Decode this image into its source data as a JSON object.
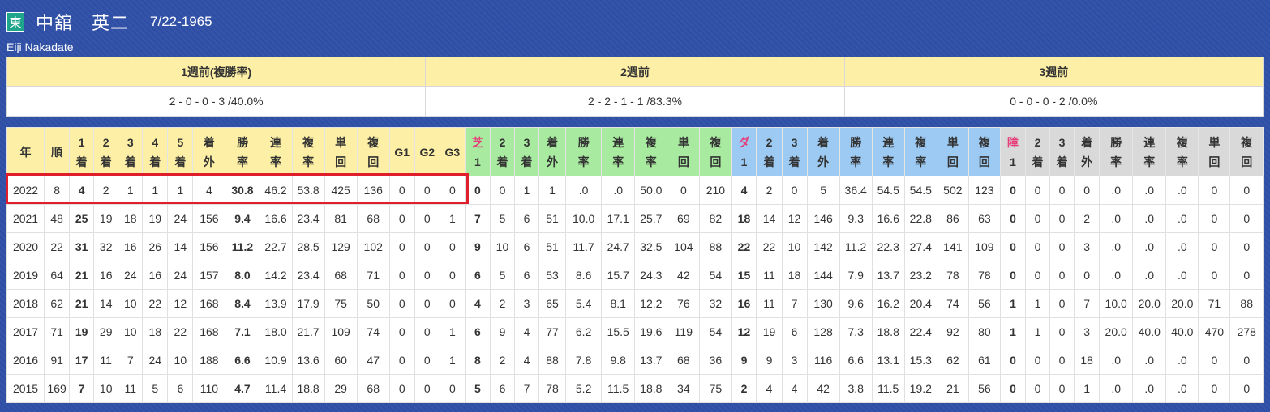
{
  "jockey": {
    "tozai_badge": "東",
    "name": "中舘　英二",
    "birthdate": "7/22-1965",
    "romaji": "Eiji Nakadate"
  },
  "recent_weeks": {
    "headers": [
      "1週前(複勝率)",
      "2週前",
      "3週前"
    ],
    "values": [
      "2 - 0 - 0 - 3 /40.0%",
      "2 - 2 - 1 - 1 /83.3%",
      "0 - 0 - 0 - 2 /0.0%"
    ]
  },
  "stats_table": {
    "headers": [
      [
        "年"
      ],
      [
        "順"
      ],
      [
        "1",
        "着"
      ],
      [
        "2",
        "着"
      ],
      [
        "3",
        "着"
      ],
      [
        "4",
        "着"
      ],
      [
        "5",
        "着"
      ],
      [
        "着",
        "外"
      ],
      [
        "勝",
        "率"
      ],
      [
        "連",
        "率"
      ],
      [
        "複",
        "率"
      ],
      [
        "単",
        "回"
      ],
      [
        "複",
        "回"
      ],
      [
        "G1"
      ],
      [
        "G2"
      ],
      [
        "G3"
      ],
      [
        "芝",
        "1"
      ],
      [
        "2",
        "着"
      ],
      [
        "3",
        "着"
      ],
      [
        "着",
        "外"
      ],
      [
        "勝",
        "率"
      ],
      [
        "連",
        "率"
      ],
      [
        "複",
        "率"
      ],
      [
        "単",
        "回"
      ],
      [
        "複",
        "回"
      ],
      [
        "ダ",
        "1"
      ],
      [
        "2",
        "着"
      ],
      [
        "3",
        "着"
      ],
      [
        "着",
        "外"
      ],
      [
        "勝",
        "率"
      ],
      [
        "連",
        "率"
      ],
      [
        "複",
        "率"
      ],
      [
        "単",
        "回"
      ],
      [
        "複",
        "回"
      ],
      [
        "障",
        "1"
      ],
      [
        "2",
        "着"
      ],
      [
        "3",
        "着"
      ],
      [
        "着",
        "外"
      ],
      [
        "勝",
        "率"
      ],
      [
        "連",
        "率"
      ],
      [
        "複",
        "率"
      ],
      [
        "単",
        "回"
      ],
      [
        "複",
        "回"
      ]
    ],
    "rows": [
      [
        "2022",
        "8",
        "4",
        "2",
        "1",
        "1",
        "1",
        "4",
        "30.8",
        "46.2",
        "53.8",
        "425",
        "136",
        "0",
        "0",
        "0",
        "0",
        "0",
        "1",
        "1",
        ".0",
        ".0",
        "50.0",
        "0",
        "210",
        "4",
        "2",
        "0",
        "5",
        "36.4",
        "54.5",
        "54.5",
        "502",
        "123",
        "0",
        "0",
        "0",
        "0",
        ".0",
        ".0",
        ".0",
        "0",
        "0"
      ],
      [
        "2021",
        "48",
        "25",
        "19",
        "18",
        "19",
        "24",
        "156",
        "9.4",
        "16.6",
        "23.4",
        "81",
        "68",
        "0",
        "0",
        "1",
        "7",
        "5",
        "6",
        "51",
        "10.0",
        "17.1",
        "25.7",
        "69",
        "82",
        "18",
        "14",
        "12",
        "146",
        "9.3",
        "16.6",
        "22.8",
        "86",
        "63",
        "0",
        "0",
        "0",
        "2",
        ".0",
        ".0",
        ".0",
        "0",
        "0"
      ],
      [
        "2020",
        "22",
        "31",
        "32",
        "16",
        "26",
        "14",
        "156",
        "11.2",
        "22.7",
        "28.5",
        "129",
        "102",
        "0",
        "0",
        "0",
        "9",
        "10",
        "6",
        "51",
        "11.7",
        "24.7",
        "32.5",
        "104",
        "88",
        "22",
        "22",
        "10",
        "142",
        "11.2",
        "22.3",
        "27.4",
        "141",
        "109",
        "0",
        "0",
        "0",
        "3",
        ".0",
        ".0",
        ".0",
        "0",
        "0"
      ],
      [
        "2019",
        "64",
        "21",
        "16",
        "24",
        "16",
        "24",
        "157",
        "8.0",
        "14.2",
        "23.4",
        "68",
        "71",
        "0",
        "0",
        "0",
        "6",
        "5",
        "6",
        "53",
        "8.6",
        "15.7",
        "24.3",
        "42",
        "54",
        "15",
        "11",
        "18",
        "144",
        "7.9",
        "13.7",
        "23.2",
        "78",
        "78",
        "0",
        "0",
        "0",
        "0",
        ".0",
        ".0",
        ".0",
        "0",
        "0"
      ],
      [
        "2018",
        "62",
        "21",
        "14",
        "10",
        "22",
        "12",
        "168",
        "8.4",
        "13.9",
        "17.9",
        "75",
        "50",
        "0",
        "0",
        "0",
        "4",
        "2",
        "3",
        "65",
        "5.4",
        "8.1",
        "12.2",
        "76",
        "32",
        "16",
        "11",
        "7",
        "130",
        "9.6",
        "16.2",
        "20.4",
        "74",
        "56",
        "1",
        "1",
        "0",
        "7",
        "10.0",
        "20.0",
        "20.0",
        "71",
        "88"
      ],
      [
        "2017",
        "71",
        "19",
        "29",
        "10",
        "18",
        "22",
        "168",
        "7.1",
        "18.0",
        "21.7",
        "109",
        "74",
        "0",
        "0",
        "1",
        "6",
        "9",
        "4",
        "77",
        "6.2",
        "15.5",
        "19.6",
        "119",
        "54",
        "12",
        "19",
        "6",
        "128",
        "7.3",
        "18.8",
        "22.4",
        "92",
        "80",
        "1",
        "1",
        "0",
        "3",
        "20.0",
        "40.0",
        "40.0",
        "470",
        "278"
      ],
      [
        "2016",
        "91",
        "17",
        "11",
        "7",
        "24",
        "10",
        "188",
        "6.6",
        "10.9",
        "13.6",
        "60",
        "47",
        "0",
        "0",
        "1",
        "8",
        "2",
        "4",
        "88",
        "7.8",
        "9.8",
        "13.7",
        "68",
        "36",
        "9",
        "9",
        "3",
        "116",
        "6.6",
        "13.1",
        "15.3",
        "62",
        "61",
        "0",
        "0",
        "0",
        "18",
        ".0",
        ".0",
        ".0",
        "0",
        "0"
      ],
      [
        "2015",
        "169",
        "7",
        "10",
        "11",
        "5",
        "6",
        "110",
        "4.7",
        "11.4",
        "18.8",
        "29",
        "68",
        "0",
        "0",
        "0",
        "5",
        "6",
        "7",
        "78",
        "5.2",
        "11.5",
        "18.8",
        "34",
        "75",
        "2",
        "4",
        "4",
        "42",
        "3.8",
        "11.5",
        "19.2",
        "21",
        "56",
        "0",
        "0",
        "0",
        "1",
        ".0",
        ".0",
        ".0",
        "0",
        "0"
      ]
    ]
  },
  "colors": {
    "background": "#2f4fa6",
    "overall_header": "#fdf0a6",
    "turf_header": "#a8eba0",
    "dirt_header": "#9ccaf3",
    "jump_header": "#d9d9d9",
    "highlight_border": "#e01e2c",
    "first_char_accent": "#e63d7a"
  }
}
